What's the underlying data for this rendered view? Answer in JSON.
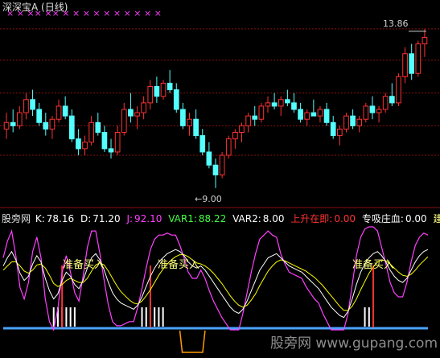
{
  "title": "深深宝A (日线)",
  "price_panel": {
    "high_label": "13.86",
    "low_label": "9.00",
    "grid_levels": [
      13.86,
      12.9,
      11.9,
      10.9,
      10.0
    ],
    "signal_marks": "× × ×× ×× × × × × × × × × × ×",
    "candles": [
      [
        10.8,
        11.3,
        10.5,
        11.0
      ],
      [
        11.0,
        11.4,
        10.7,
        10.9
      ],
      [
        10.9,
        11.5,
        10.8,
        11.3
      ],
      [
        11.3,
        11.9,
        11.1,
        11.7
      ],
      [
        11.7,
        12.0,
        11.2,
        11.4
      ],
      [
        11.4,
        11.6,
        10.9,
        11.0
      ],
      [
        11.0,
        11.3,
        10.6,
        10.8
      ],
      [
        10.8,
        11.2,
        10.5,
        11.1
      ],
      [
        11.1,
        11.7,
        11.0,
        11.5
      ],
      [
        11.5,
        11.8,
        11.1,
        11.2
      ],
      [
        11.2,
        11.4,
        10.4,
        10.5
      ],
      [
        10.5,
        10.8,
        10.0,
        10.2
      ],
      [
        10.2,
        10.6,
        10.0,
        10.4
      ],
      [
        10.4,
        11.2,
        10.3,
        11.0
      ],
      [
        11.0,
        11.3,
        10.6,
        10.7
      ],
      [
        10.7,
        10.9,
        10.1,
        10.2
      ],
      [
        10.2,
        10.5,
        9.9,
        10.1
      ],
      [
        10.1,
        10.9,
        10.0,
        10.7
      ],
      [
        10.7,
        11.6,
        10.6,
        11.4
      ],
      [
        11.4,
        11.9,
        11.0,
        11.2
      ],
      [
        11.2,
        11.5,
        10.8,
        11.3
      ],
      [
        11.3,
        11.8,
        11.1,
        11.6
      ],
      [
        11.6,
        12.3,
        11.4,
        12.1
      ],
      [
        12.1,
        12.4,
        11.6,
        11.8
      ],
      [
        11.8,
        12.3,
        11.7,
        12.2
      ],
      [
        12.2,
        12.6,
        11.9,
        12.0
      ],
      [
        12.0,
        12.2,
        11.3,
        11.4
      ],
      [
        11.4,
        11.6,
        10.8,
        10.9
      ],
      [
        10.9,
        11.3,
        10.6,
        11.1
      ],
      [
        11.1,
        11.4,
        10.5,
        10.6
      ],
      [
        10.6,
        10.8,
        10.0,
        10.1
      ],
      [
        10.1,
        10.4,
        9.6,
        9.7
      ],
      [
        9.7,
        9.9,
        9.0,
        9.4
      ],
      [
        9.4,
        10.1,
        9.3,
        10.0
      ],
      [
        10.0,
        10.6,
        9.9,
        10.5
      ],
      [
        10.5,
        10.8,
        10.2,
        10.7
      ],
      [
        10.7,
        11.0,
        10.4,
        10.9
      ],
      [
        10.9,
        11.3,
        10.7,
        11.2
      ],
      [
        11.2,
        11.5,
        10.9,
        11.1
      ],
      [
        11.1,
        11.6,
        11.0,
        11.5
      ],
      [
        11.5,
        11.8,
        11.3,
        11.6
      ],
      [
        11.6,
        11.9,
        11.4,
        11.5
      ],
      [
        11.5,
        11.8,
        11.2,
        11.7
      ],
      [
        11.7,
        12.0,
        11.5,
        11.6
      ],
      [
        11.6,
        11.9,
        11.3,
        11.4
      ],
      [
        11.4,
        11.6,
        11.0,
        11.1
      ],
      [
        11.1,
        11.4,
        10.9,
        11.3
      ],
      [
        11.3,
        11.7,
        11.2,
        11.2
      ],
      [
        11.2,
        11.5,
        11.0,
        11.4
      ],
      [
        11.4,
        11.6,
        10.9,
        11.0
      ],
      [
        11.0,
        11.2,
        10.5,
        10.6
      ],
      [
        10.6,
        10.9,
        10.3,
        10.8
      ],
      [
        10.8,
        11.3,
        10.7,
        11.2
      ],
      [
        11.2,
        11.4,
        10.8,
        10.9
      ],
      [
        10.9,
        11.2,
        10.7,
        11.1
      ],
      [
        11.1,
        11.6,
        11.0,
        11.5
      ],
      [
        11.5,
        11.8,
        11.1,
        11.3
      ],
      [
        11.3,
        11.5,
        11.0,
        11.4
      ],
      [
        11.4,
        11.9,
        11.3,
        11.8
      ],
      [
        11.8,
        12.2,
        11.5,
        11.6
      ],
      [
        11.6,
        12.5,
        11.5,
        12.4
      ],
      [
        12.4,
        13.3,
        12.2,
        13.1
      ],
      [
        13.1,
        13.4,
        12.3,
        12.5
      ],
      [
        12.5,
        13.5,
        12.4,
        13.4
      ],
      [
        13.4,
        13.86,
        13.0,
        13.6
      ]
    ]
  },
  "indicator": {
    "name": "股旁网",
    "k": {
      "label": "K:",
      "value": "78.16"
    },
    "d": {
      "label": "D:",
      "value": "71.20"
    },
    "j": {
      "label": "J:",
      "value": "92.10"
    },
    "var1": {
      "label": "VAR1:",
      "value": "88.22"
    },
    "var2": {
      "label": "VAR2:",
      "value": "8.00"
    },
    "rise": {
      "label": "上升在即:",
      "value": "0.00"
    },
    "absorb": {
      "label": "专吸庄血:",
      "value": "0.00"
    },
    "build": {
      "label": "建仓["
    },
    "buy_label": "准备买入",
    "buy_signals": [
      {
        "index": 14,
        "label": "准备买入"
      },
      {
        "index": 35,
        "label": "准备买入"
      },
      {
        "index": 88,
        "label": "准备买入"
      }
    ],
    "k_series": [
      62,
      70,
      76,
      68,
      55,
      48,
      52,
      64,
      72,
      66,
      50,
      38,
      30,
      35,
      48,
      56,
      52,
      44,
      40,
      48,
      60,
      70,
      74,
      68,
      58,
      46,
      36,
      30,
      26,
      24,
      22,
      20,
      24,
      32,
      42,
      52,
      60,
      66,
      70,
      74,
      76,
      78,
      76,
      72,
      66,
      62,
      60,
      62,
      58,
      52,
      46,
      40,
      34,
      28,
      22,
      18,
      16,
      20,
      28,
      38,
      48,
      58,
      64,
      70,
      72,
      74,
      70,
      66,
      62,
      60,
      58,
      56,
      52,
      48,
      44,
      40,
      34,
      28,
      22,
      18,
      14,
      12,
      18,
      30,
      44,
      56,
      64,
      70,
      74,
      76,
      72,
      66,
      58,
      52,
      48,
      46,
      50,
      58,
      66,
      72,
      76,
      78
    ],
    "d_series": [
      58,
      62,
      66,
      66,
      62,
      57,
      55,
      58,
      63,
      64,
      60,
      53,
      45,
      42,
      44,
      48,
      50,
      48,
      46,
      46,
      50,
      57,
      63,
      65,
      63,
      57,
      50,
      43,
      37,
      33,
      29,
      26,
      25,
      28,
      33,
      39,
      46,
      53,
      59,
      64,
      68,
      71,
      73,
      73,
      71,
      68,
      65,
      64,
      62,
      59,
      55,
      50,
      45,
      39,
      33,
      28,
      24,
      22,
      24,
      29,
      35,
      43,
      50,
      57,
      62,
      66,
      68,
      67,
      65,
      63,
      61,
      59,
      57,
      54,
      51,
      47,
      43,
      38,
      33,
      28,
      23,
      19,
      19,
      23,
      30,
      39,
      47,
      55,
      61,
      66,
      68,
      67,
      64,
      60,
      56,
      53,
      52,
      54,
      58,
      63,
      67,
      71
    ],
    "j_series": [
      70,
      86,
      96,
      72,
      41,
      30,
      46,
      76,
      90,
      70,
      30,
      8,
      0,
      21,
      56,
      72,
      56,
      36,
      28,
      52,
      80,
      96,
      96,
      74,
      48,
      24,
      8,
      4,
      4,
      6,
      8,
      8,
      22,
      40,
      60,
      78,
      88,
      92,
      92,
      94,
      92,
      92,
      82,
      70,
      56,
      50,
      50,
      58,
      50,
      38,
      28,
      20,
      12,
      6,
      0,
      0,
      0,
      16,
      36,
      56,
      74,
      88,
      92,
      96,
      92,
      90,
      74,
      64,
      56,
      54,
      52,
      50,
      42,
      36,
      30,
      26,
      16,
      8,
      0,
      0,
      0,
      0,
      16,
      44,
      72,
      90,
      98,
      100,
      100,
      96,
      80,
      64,
      46,
      36,
      32,
      32,
      46,
      66,
      82,
      90,
      94,
      92
    ],
    "bottom_markers": [
      [
        12,
        17
      ],
      [
        33,
        38
      ],
      [
        86,
        87
      ]
    ],
    "dip_range": [
      42,
      48
    ]
  },
  "watermark": "股旁网 www.gupang.com",
  "colors": {
    "up": "#ff3232",
    "down": "#54ffff",
    "grid": "#8a1010",
    "k": "#ffffff",
    "d": "#ffff00",
    "j": "#ff40ff",
    "var1": "#44ff44",
    "var2": "#ffffff",
    "rise": "#ff3232",
    "baseline": "#4aa3ff",
    "dip": "#ff9a00"
  }
}
